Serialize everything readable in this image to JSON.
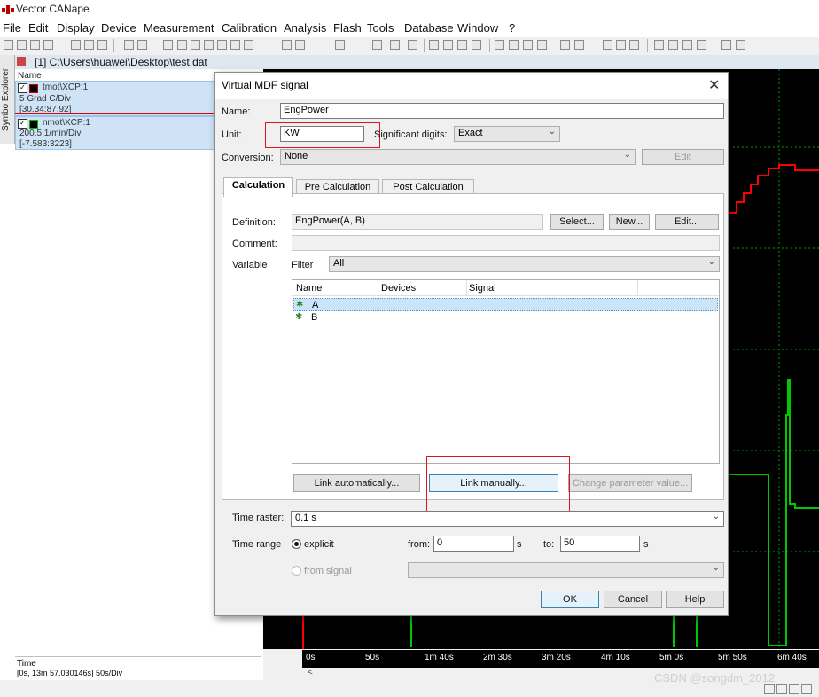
{
  "app": {
    "title": "Vector CANape"
  },
  "menu": [
    "File",
    "Edit",
    "Display",
    "Device",
    "Measurement",
    "Calibration",
    "Analysis",
    "Flash",
    "Tools",
    "Database",
    "Window",
    "?"
  ],
  "window": {
    "title": "[1] C:\\Users\\huawei\\Desktop\\test.dat"
  },
  "left_panel": {
    "side_tab": "Symbo Explorer",
    "column_header": "Name",
    "signals": [
      {
        "name": "tmot\\XCP:1",
        "scale": "5 Grad C/Div",
        "range": "[30.34:87.92]",
        "color": "#c00000"
      },
      {
        "name": "nmot\\XCP:1",
        "scale": "200.5 1/min/Div",
        "range": "[-7.583:3223]",
        "color": "#00b000"
      }
    ],
    "time_label": "Time",
    "time_value": "[0s, 13m 57.030146s] 50s/Div"
  },
  "graph": {
    "time_ticks": [
      "0s",
      "50s",
      "1m 40s",
      "2m 30s",
      "3m 20s",
      "4m 10s",
      "5m 0s",
      "5m 50s",
      "6m 40s"
    ],
    "watermark": "CSDN @songdm_2012"
  },
  "dialog": {
    "title": "Virtual MDF signal",
    "name_label": "Name:",
    "name_value": "EngPower",
    "unit_label": "Unit:",
    "unit_value": "KW",
    "sigdigits_label": "Significant digits:",
    "sigdigits_value": "Exact",
    "conversion_label": "Conversion:",
    "conversion_value": "None",
    "edit_label": "Edit",
    "tabs": [
      "Calculation",
      "Pre Calculation",
      "Post Calculation"
    ],
    "definition_label": "Definition:",
    "definition_value": "EngPower(A, B)",
    "select_label": "Select...",
    "new_label": "New...",
    "edit2_label": "Edit...",
    "comment_label": "Comment:",
    "variable_label": "Variable",
    "filter_label": "Filter",
    "filter_value": "All",
    "columns": [
      "Name",
      "Devices",
      "Signal"
    ],
    "variables": [
      "A",
      "B"
    ],
    "link_auto_label": "Link automatically...",
    "link_manual_label": "Link manually...",
    "change_param_label": "Change parameter value...",
    "time_raster_label": "Time raster:",
    "time_raster_value": "0.1 s",
    "time_range_label": "Time range",
    "explicit_label": "explicit",
    "from_label": "from:",
    "from_value": "0",
    "from_unit": "s",
    "to_label": "to:",
    "to_value": "50",
    "to_unit": "s",
    "from_signal_label": "from signal",
    "ok_label": "OK",
    "cancel_label": "Cancel",
    "help_label": "Help"
  },
  "colors": {
    "highlight": "#e0141d",
    "signal_red": "#ff0000",
    "signal_green": "#00c800"
  }
}
